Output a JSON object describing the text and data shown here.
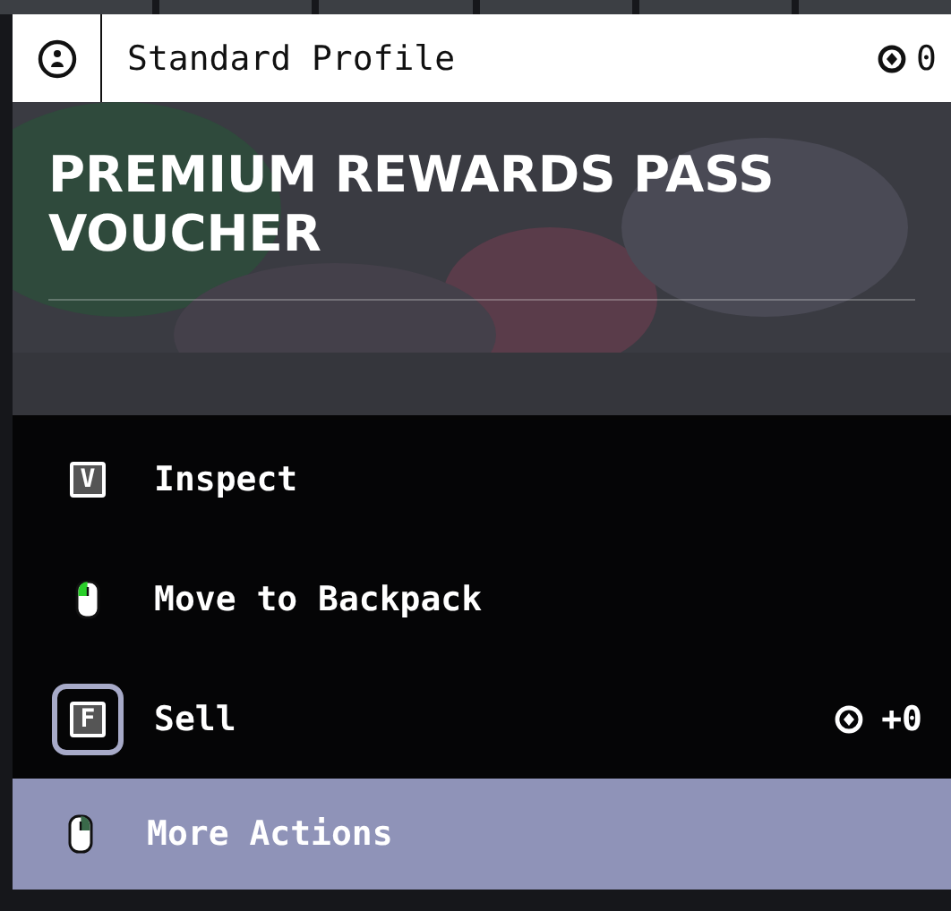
{
  "header": {
    "profile": "Standard Profile",
    "currency": "0"
  },
  "item": {
    "title": "PREMIUM REWARDS PASS VOUCHER"
  },
  "actions": [
    {
      "kind": "key",
      "key": "V",
      "label": "Inspect",
      "focused": false,
      "highlighted": false
    },
    {
      "kind": "left-click",
      "label": "Move to Backpack",
      "focused": false,
      "highlighted": false
    },
    {
      "kind": "key",
      "key": "F",
      "label": "Sell",
      "focused": true,
      "highlighted": false,
      "price": "+0"
    },
    {
      "kind": "right-click",
      "label": "More Actions",
      "focused": false,
      "highlighted": true
    }
  ]
}
